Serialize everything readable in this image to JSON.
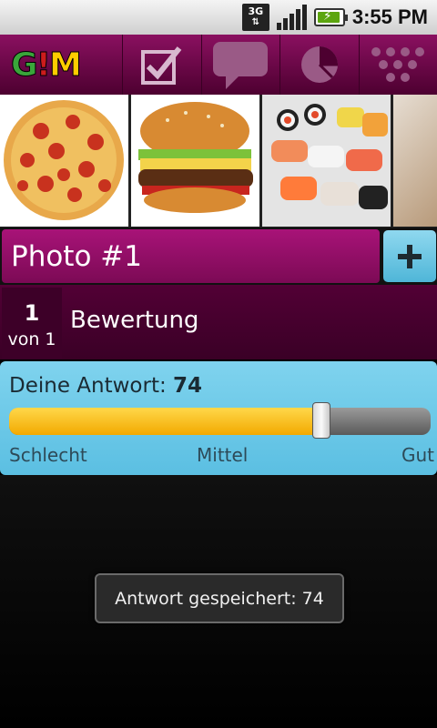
{
  "status_bar": {
    "network": "3G",
    "time": "3:55 PM",
    "icons": [
      "network-3g-icon",
      "signal-icon",
      "battery-charging-icon"
    ]
  },
  "toolbar": {
    "logo_text_g": "G",
    "logo_text_m": "M",
    "items": [
      {
        "name": "checkbox-icon"
      },
      {
        "name": "comment-icon"
      },
      {
        "name": "pie-chart-icon"
      },
      {
        "name": "network-icon"
      }
    ]
  },
  "photos": [
    {
      "name": "pizza"
    },
    {
      "name": "burger"
    },
    {
      "name": "sushi"
    },
    {
      "name": "wrap"
    }
  ],
  "photo_title": "Photo #1",
  "add_button_icon": "plus-icon",
  "question": {
    "index": "1",
    "of_label": "von 1",
    "label": "Bewertung"
  },
  "answer": {
    "label": "Deine Antwort:",
    "value": "74",
    "slider_percent": 74,
    "scale_low": "Schlecht",
    "scale_mid": "Mittel",
    "scale_high": "Gut"
  },
  "toast": "Antwort gespeichert: 74",
  "colors": {
    "brand": "#8a1060",
    "accent": "#5bbfe2",
    "slider_fill": "#f2a900"
  }
}
